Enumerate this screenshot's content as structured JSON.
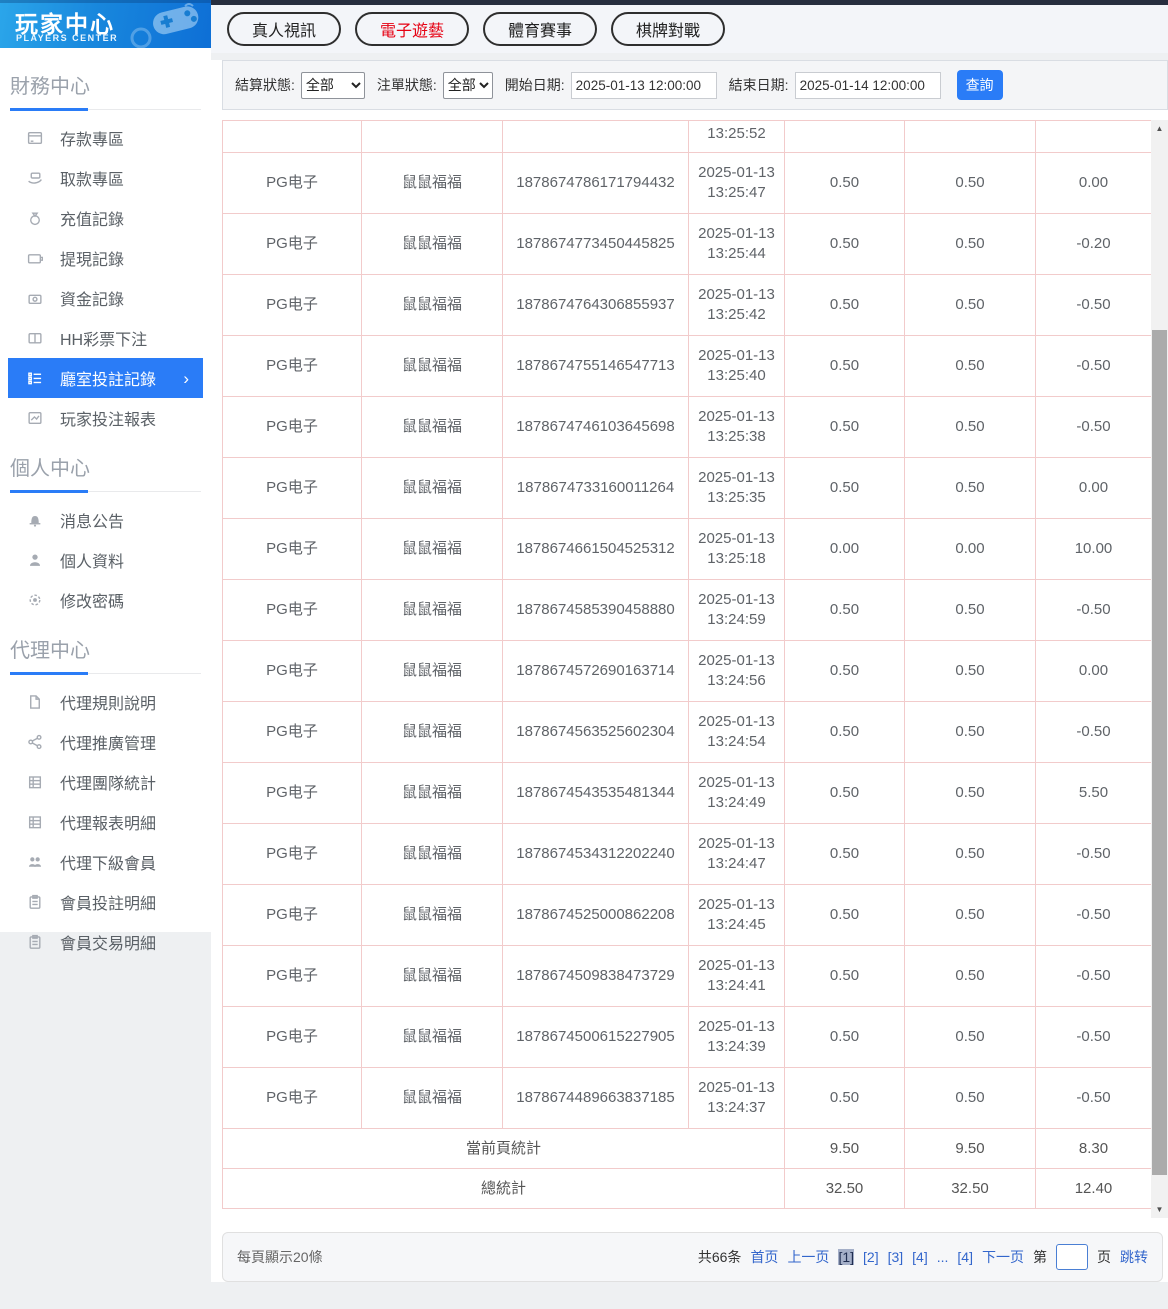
{
  "brand": {
    "title": "玩家中心",
    "subtitle": "PLAYERS CENTER",
    "logo_icon": "gamepad-icon"
  },
  "top_tabs": [
    {
      "name": "live-video",
      "label": "真人視訊",
      "active": false
    },
    {
      "name": "electronic-games",
      "label": "電子遊藝",
      "active": true
    },
    {
      "name": "sports-events",
      "label": "體育賽事",
      "active": false
    },
    {
      "name": "board-card-games",
      "label": "棋牌對戰",
      "active": false
    }
  ],
  "filters": {
    "settle_status_label": "結算狀態:",
    "settle_status_value": "全部",
    "order_status_label": "注單狀態:",
    "order_status_value": "全部",
    "start_label": "開始日期:",
    "start_value": "2025-01-13 12:00:00",
    "end_label": "結束日期:",
    "end_value": "2025-01-14 12:00:00",
    "query_label": "查詢"
  },
  "sidebar": {
    "sections": [
      {
        "title": "財務中心",
        "items": [
          {
            "name": "deposit-zone",
            "label": "存款專區",
            "icon": "deposit-icon",
            "active": false
          },
          {
            "name": "withdraw-zone",
            "label": "取款專區",
            "icon": "withdraw-icon",
            "active": false
          },
          {
            "name": "recharge-records",
            "label": "充值記錄",
            "icon": "recharge-record-icon",
            "active": false
          },
          {
            "name": "withdrawal-records",
            "label": "提現記錄",
            "icon": "withdrawal-record-icon",
            "active": false
          },
          {
            "name": "fund-records",
            "label": "資金記錄",
            "icon": "funds-record-icon",
            "active": false
          },
          {
            "name": "hh-lottery-bets",
            "label": "HH彩票下注",
            "icon": "lottery-bet-icon",
            "active": false
          },
          {
            "name": "room-bet-records",
            "label": "廳室投註記錄",
            "icon": "room-bet-record-icon",
            "active": true
          },
          {
            "name": "player-bet-report",
            "label": "玩家投注報表",
            "icon": "player-bet-report-icon",
            "active": false
          }
        ]
      },
      {
        "title": "個人中心",
        "items": [
          {
            "name": "announcements",
            "label": "消息公告",
            "icon": "bell-icon",
            "active": false
          },
          {
            "name": "profile",
            "label": "個人資料",
            "icon": "person-icon",
            "active": false
          },
          {
            "name": "change-password",
            "label": "修改密碼",
            "icon": "gear-icon",
            "active": false
          }
        ]
      },
      {
        "title": "代理中心",
        "items": [
          {
            "name": "agent-rules",
            "label": "代理規則說明",
            "icon": "document-icon",
            "active": false
          },
          {
            "name": "agent-promotion",
            "label": "代理推廣管理",
            "icon": "share-icon",
            "active": false
          },
          {
            "name": "agent-team-stats",
            "label": "代理團隊統計",
            "icon": "report-icon",
            "active": false
          },
          {
            "name": "agent-report-detail",
            "label": "代理報表明細",
            "icon": "report-icon",
            "active": false
          },
          {
            "name": "agent-sub-members",
            "label": "代理下級會員",
            "icon": "members-icon",
            "active": false
          },
          {
            "name": "member-bet-detail",
            "label": "會員投註明細",
            "icon": "clipboard-icon",
            "active": false
          },
          {
            "name": "member-transaction-detail",
            "label": "會員交易明細",
            "icon": "clipboard-icon",
            "active": false
          }
        ]
      }
    ]
  },
  "table": {
    "partial_row_time": "13:25:52",
    "rows": [
      {
        "platform": "PG电子",
        "game": "鼠鼠福福",
        "order": "1878674786171794432",
        "date": "2025-01-13",
        "time": "13:25:47",
        "bet": "0.50",
        "valid": "0.50",
        "profit": "0.00"
      },
      {
        "platform": "PG电子",
        "game": "鼠鼠福福",
        "order": "1878674773450445825",
        "date": "2025-01-13",
        "time": "13:25:44",
        "bet": "0.50",
        "valid": "0.50",
        "profit": "-0.20"
      },
      {
        "platform": "PG电子",
        "game": "鼠鼠福福",
        "order": "1878674764306855937",
        "date": "2025-01-13",
        "time": "13:25:42",
        "bet": "0.50",
        "valid": "0.50",
        "profit": "-0.50"
      },
      {
        "platform": "PG电子",
        "game": "鼠鼠福福",
        "order": "1878674755146547713",
        "date": "2025-01-13",
        "time": "13:25:40",
        "bet": "0.50",
        "valid": "0.50",
        "profit": "-0.50"
      },
      {
        "platform": "PG电子",
        "game": "鼠鼠福福",
        "order": "1878674746103645698",
        "date": "2025-01-13",
        "time": "13:25:38",
        "bet": "0.50",
        "valid": "0.50",
        "profit": "-0.50"
      },
      {
        "platform": "PG电子",
        "game": "鼠鼠福福",
        "order": "1878674733160011264",
        "date": "2025-01-13",
        "time": "13:25:35",
        "bet": "0.50",
        "valid": "0.50",
        "profit": "0.00"
      },
      {
        "platform": "PG电子",
        "game": "鼠鼠福福",
        "order": "1878674661504525312",
        "date": "2025-01-13",
        "time": "13:25:18",
        "bet": "0.00",
        "valid": "0.00",
        "profit": "10.00"
      },
      {
        "platform": "PG电子",
        "game": "鼠鼠福福",
        "order": "1878674585390458880",
        "date": "2025-01-13",
        "time": "13:24:59",
        "bet": "0.50",
        "valid": "0.50",
        "profit": "-0.50"
      },
      {
        "platform": "PG电子",
        "game": "鼠鼠福福",
        "order": "1878674572690163714",
        "date": "2025-01-13",
        "time": "13:24:56",
        "bet": "0.50",
        "valid": "0.50",
        "profit": "0.00"
      },
      {
        "platform": "PG电子",
        "game": "鼠鼠福福",
        "order": "1878674563525602304",
        "date": "2025-01-13",
        "time": "13:24:54",
        "bet": "0.50",
        "valid": "0.50",
        "profit": "-0.50"
      },
      {
        "platform": "PG电子",
        "game": "鼠鼠福福",
        "order": "1878674543535481344",
        "date": "2025-01-13",
        "time": "13:24:49",
        "bet": "0.50",
        "valid": "0.50",
        "profit": "5.50"
      },
      {
        "platform": "PG电子",
        "game": "鼠鼠福福",
        "order": "1878674534312202240",
        "date": "2025-01-13",
        "time": "13:24:47",
        "bet": "0.50",
        "valid": "0.50",
        "profit": "-0.50"
      },
      {
        "platform": "PG电子",
        "game": "鼠鼠福福",
        "order": "1878674525000862208",
        "date": "2025-01-13",
        "time": "13:24:45",
        "bet": "0.50",
        "valid": "0.50",
        "profit": "-0.50"
      },
      {
        "platform": "PG电子",
        "game": "鼠鼠福福",
        "order": "1878674509838473729",
        "date": "2025-01-13",
        "time": "13:24:41",
        "bet": "0.50",
        "valid": "0.50",
        "profit": "-0.50"
      },
      {
        "platform": "PG电子",
        "game": "鼠鼠福福",
        "order": "1878674500615227905",
        "date": "2025-01-13",
        "time": "13:24:39",
        "bet": "0.50",
        "valid": "0.50",
        "profit": "-0.50"
      },
      {
        "platform": "PG电子",
        "game": "鼠鼠福福",
        "order": "1878674489663837185",
        "date": "2025-01-13",
        "time": "13:24:37",
        "bet": "0.50",
        "valid": "0.50",
        "profit": "-0.50"
      }
    ],
    "summaries": [
      {
        "label": "當前頁統計",
        "bet": "9.50",
        "valid": "9.50",
        "profit": "8.30"
      },
      {
        "label": "總統計",
        "bet": "32.50",
        "valid": "32.50",
        "profit": "12.40"
      }
    ]
  },
  "pagination": {
    "per_page": "每頁顯示20條",
    "total": "共66条",
    "first": "首页",
    "prev": "上一页",
    "pages": [
      {
        "label": "[1]",
        "current": true
      },
      {
        "label": "[2]",
        "current": false
      },
      {
        "label": "[3]",
        "current": false
      },
      {
        "label": "[4]",
        "current": false
      },
      {
        "label": "...",
        "current": false
      },
      {
        "label": "[4]",
        "current": false
      }
    ],
    "next": "下一页",
    "jump_prefix": "第",
    "jump_value": "",
    "jump_suffix": "页",
    "jump_action": "跳转"
  },
  "colors": {
    "accent_blue": "#2a7cf7",
    "link_blue": "#3366cc",
    "active_tab_red": "#e60012",
    "table_border_pink": "#f2cbcb",
    "top_strip": "#272e3f"
  }
}
